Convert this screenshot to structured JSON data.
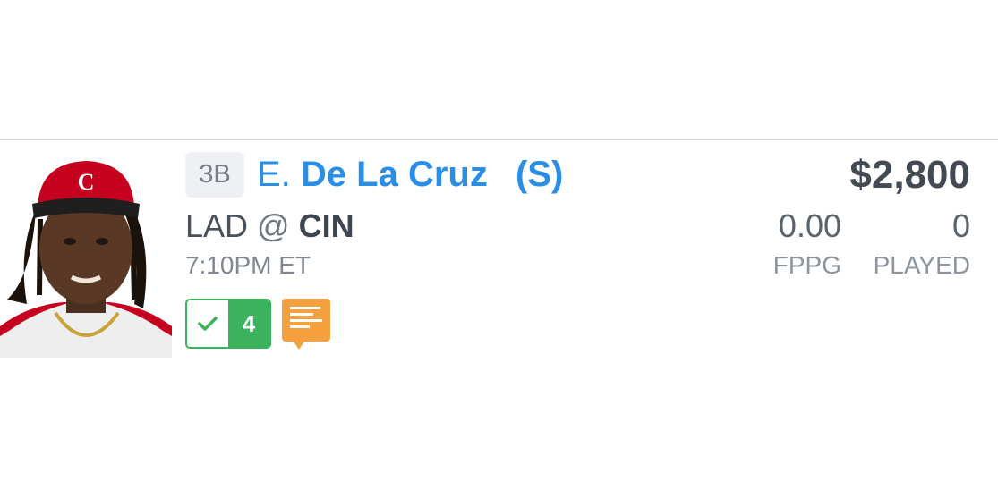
{
  "player": {
    "position": "3B",
    "first_initial": "E.",
    "last_name": "De La Cruz",
    "hand": "(S)",
    "salary": "$2,800",
    "photo_icon": "player-headshot"
  },
  "game": {
    "away": "LAD",
    "at": "@",
    "home": "CIN",
    "time": "7:10PM ET"
  },
  "stats": {
    "fppg_value": "0.00",
    "fppg_label": "FPPG",
    "played_value": "0",
    "played_label": "PLAYED"
  },
  "badges": {
    "check_icon": "check-icon",
    "check_count": "4",
    "notes_icon": "news-notes-icon"
  },
  "colors": {
    "name_blue": "#2a8ee6",
    "check_green": "#3ab35c",
    "notes_orange": "#f5a03e",
    "reds_red": "#c6011f"
  }
}
